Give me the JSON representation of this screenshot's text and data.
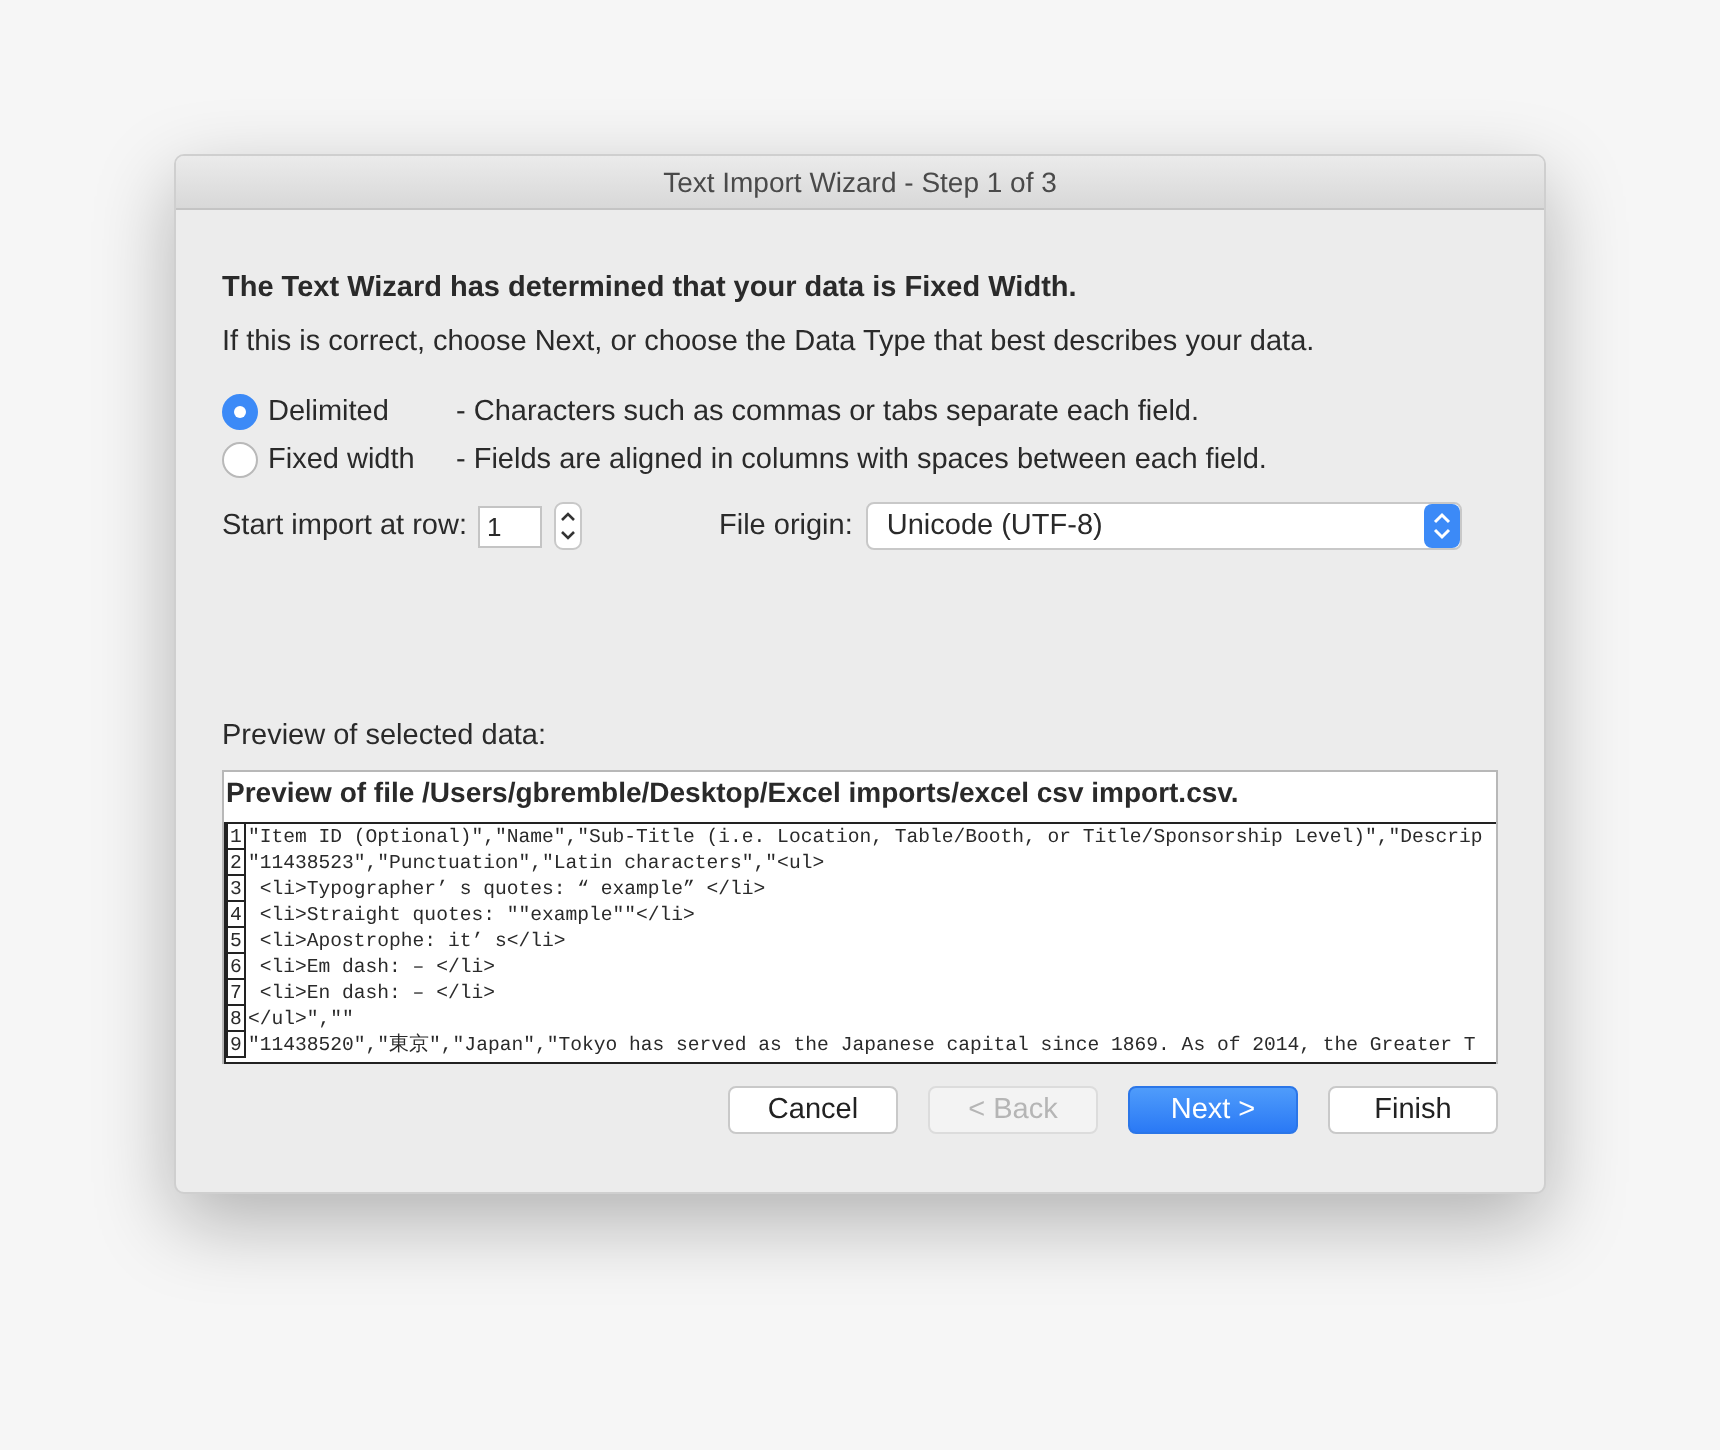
{
  "window": {
    "title": "Text Import Wizard - Step 1 of 3"
  },
  "heading": "The Text Wizard has determined that your data is Fixed Width.",
  "instruction": "If this is correct, choose Next, or choose the Data Type that best describes your data.",
  "data_types": [
    {
      "label": "Delimited",
      "description": "- Characters such as commas or tabs separate each field.",
      "selected": true
    },
    {
      "label": "Fixed width",
      "description": "- Fields are aligned in columns with spaces between each field.",
      "selected": false
    }
  ],
  "start_row": {
    "label": "Start import at row:",
    "value": "1"
  },
  "file_origin": {
    "label": "File origin:",
    "value": "Unicode (UTF-8)"
  },
  "preview": {
    "label": "Preview of selected data:",
    "title": "Preview of file /Users/gbremble/Desktop/Excel imports/excel csv import.csv.",
    "lines": [
      {
        "number": "1",
        "text": "\"Item ID (Optional)\",\"Name\",\"Sub-Title (i.e. Location, Table/Booth, or Title/Sponsorship Level)\",\"Descrip"
      },
      {
        "number": "2",
        "text": "\"11438523\",\"Punctuation\",\"Latin characters\",\"<ul>"
      },
      {
        "number": "3",
        "text": " <li>Typographer’ s quotes: “ example” </li>"
      },
      {
        "number": "4",
        "text": " <li>Straight quotes: \"\"example\"\"</li>"
      },
      {
        "number": "5",
        "text": " <li>Apostrophe: it’ s</li>"
      },
      {
        "number": "6",
        "text": " <li>Em dash: – </li>"
      },
      {
        "number": "7",
        "text": " <li>En dash: – </li>"
      },
      {
        "number": "8",
        "text": "</ul>\",\"\""
      },
      {
        "number": "9",
        "text": "\"11438520\",\"東京\",\"Japan\",\"Tokyo has served as the Japanese capital since 1869. As of 2014, the Greater T"
      }
    ]
  },
  "buttons": [
    {
      "label": "Cancel",
      "kind": "default",
      "disabled": false
    },
    {
      "label": "< Back",
      "kind": "default",
      "disabled": true
    },
    {
      "label": "Next >",
      "kind": "primary",
      "disabled": false
    },
    {
      "label": "Finish",
      "kind": "default",
      "disabled": false
    }
  ]
}
